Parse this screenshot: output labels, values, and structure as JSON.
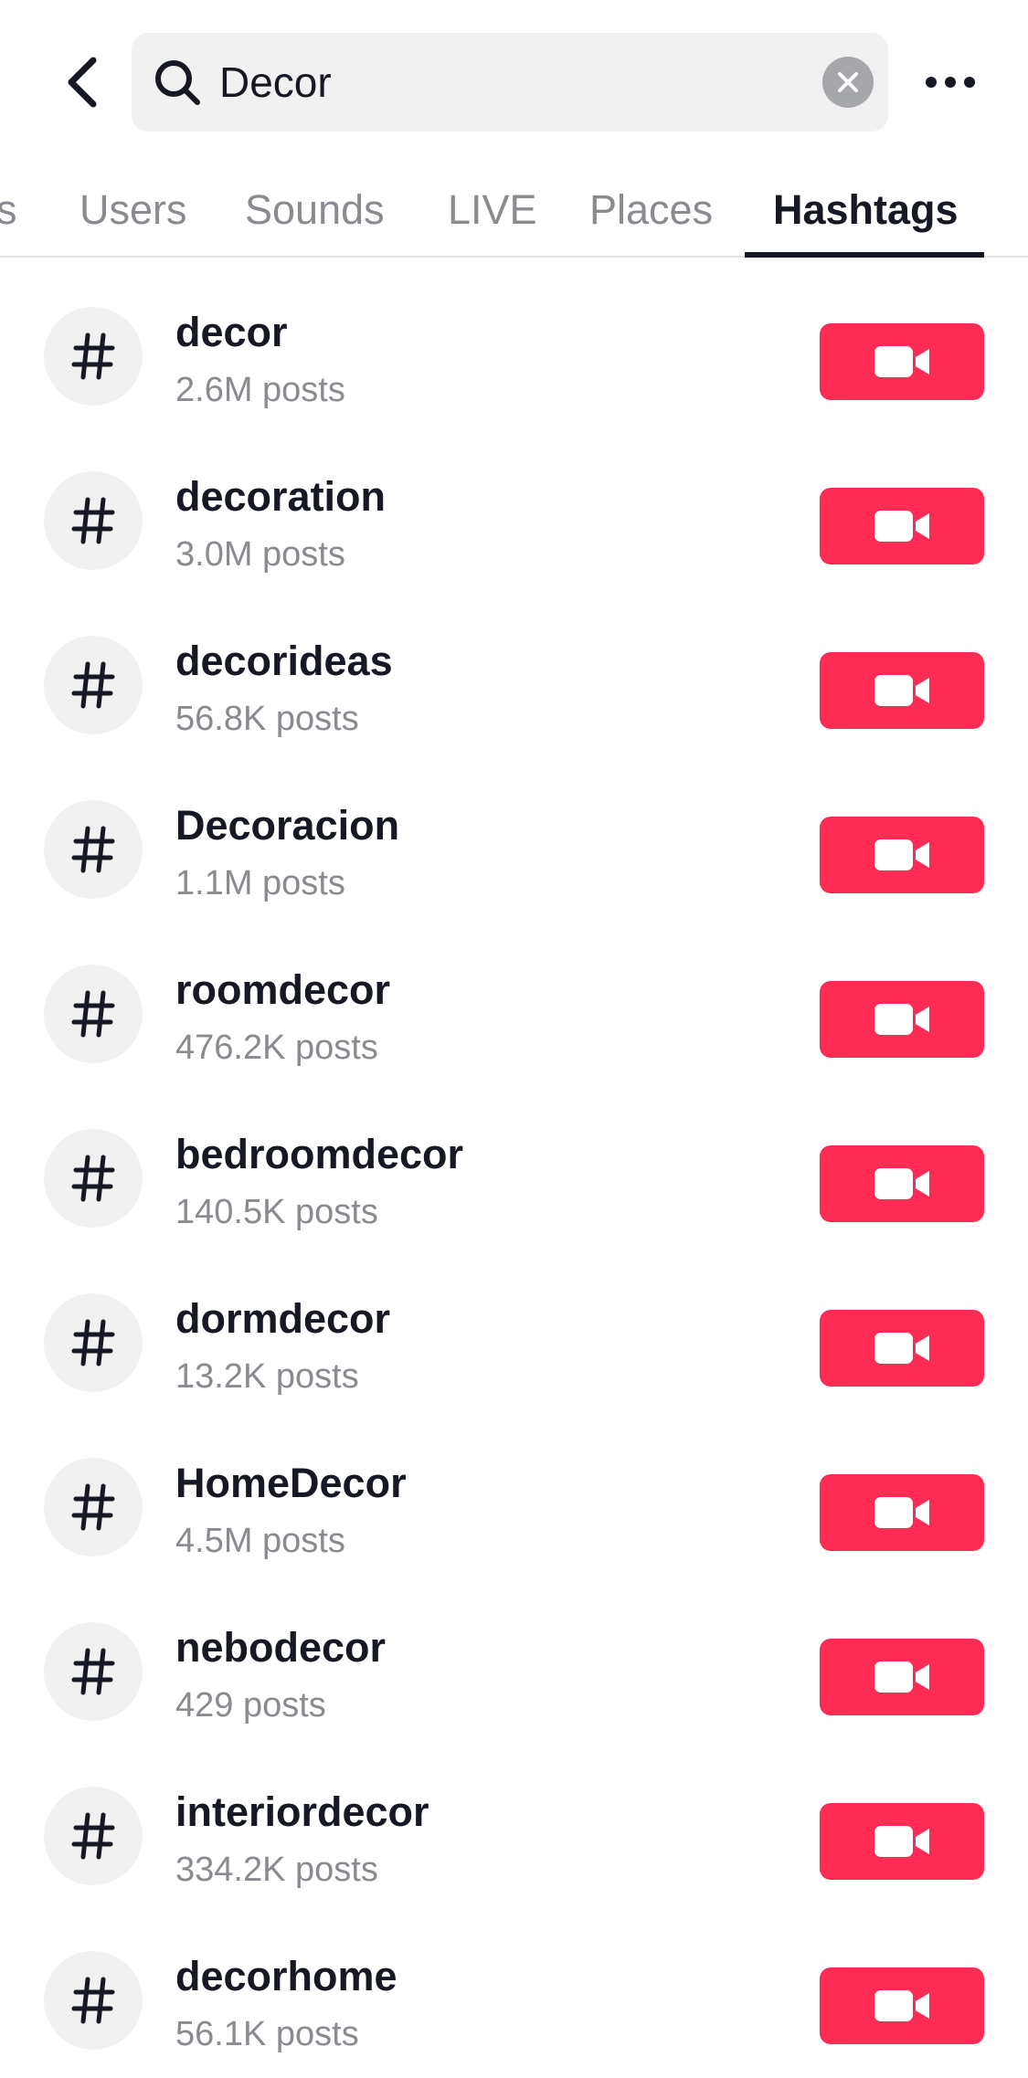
{
  "search": {
    "value": "Decor",
    "icons": {
      "back": "chevron-left-icon",
      "search": "search-icon",
      "clear": "close-icon",
      "more": "more-horizontal-icon"
    }
  },
  "tabs": [
    {
      "label": "s",
      "active": false
    },
    {
      "label": "Users",
      "active": false
    },
    {
      "label": "Sounds",
      "active": false
    },
    {
      "label": "LIVE",
      "active": false
    },
    {
      "label": "Places",
      "active": false
    },
    {
      "label": "Hashtags",
      "active": true
    }
  ],
  "hashtags": [
    {
      "name": "decor",
      "posts": "2.6M posts"
    },
    {
      "name": "decoration",
      "posts": "3.0M posts"
    },
    {
      "name": "decorideas",
      "posts": "56.8K posts"
    },
    {
      "name": "Decoracion",
      "posts": "1.1M posts"
    },
    {
      "name": "roomdecor",
      "posts": "476.2K posts"
    },
    {
      "name": "bedroomdecor",
      "posts": "140.5K posts"
    },
    {
      "name": "dormdecor",
      "posts": "13.2K posts"
    },
    {
      "name": "HomeDecor",
      "posts": "4.5M posts"
    },
    {
      "name": "nebodecor",
      "posts": "429 posts"
    },
    {
      "name": "interiordecor",
      "posts": "334.2K posts"
    },
    {
      "name": "decorhome",
      "posts": "56.1K posts"
    }
  ],
  "colors": {
    "accent": "#fe2c55",
    "text_primary": "#161823",
    "text_secondary": "#8a8b91",
    "surface": "#f1f1f2"
  }
}
